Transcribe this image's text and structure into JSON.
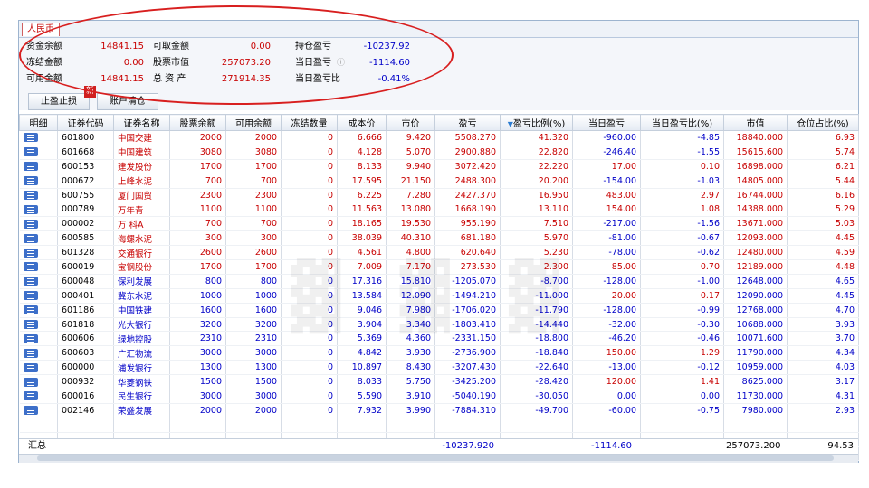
{
  "tab": {
    "label": "人民币"
  },
  "account": {
    "cash_balance_label": "资金余额",
    "cash_balance": "14841.15",
    "withdrawable_label": "可取金额",
    "withdrawable": "0.00",
    "position_pl_label": "持仓盈亏",
    "position_pl": "-10237.92",
    "frozen_label": "冻结金额",
    "frozen": "0.00",
    "stock_value_label": "股票市值",
    "stock_value": "257073.20",
    "today_pl_label": "当日盈亏",
    "today_pl": "-1114.60",
    "available_label": "可用金额",
    "available": "14841.15",
    "total_assets_label": "总 资 产",
    "total_assets": "271914.35",
    "today_pl_ratio_label": "当日盈亏比",
    "today_pl_ratio": "-0.41%"
  },
  "buttons": {
    "stop_label": "止盈止损",
    "new_badge": "新",
    "clear_label": "账户清仓"
  },
  "columns": [
    "明细",
    "证券代码",
    "证券名称",
    "股票余额",
    "可用余额",
    "冻结数量",
    "成本价",
    "市价",
    "盈亏",
    "盈亏比例(%)",
    "当日盈亏",
    "当日盈亏比(%)",
    "市值",
    "仓位占比(%)"
  ],
  "rows": [
    {
      "code": "601800",
      "name": "中国交建",
      "bal": "2000",
      "avail": "2000",
      "frozen": "0",
      "cost": "6.666",
      "price": "9.420",
      "pl": "5508.270",
      "plr": "41.320",
      "dpl": "-960.00",
      "dplr": "-4.85",
      "mv": "18840.000",
      "pos": "6.93",
      "up": true
    },
    {
      "code": "601668",
      "name": "中国建筑",
      "bal": "3080",
      "avail": "3080",
      "frozen": "0",
      "cost": "4.128",
      "price": "5.070",
      "pl": "2900.880",
      "plr": "22.820",
      "dpl": "-246.40",
      "dplr": "-1.55",
      "mv": "15615.600",
      "pos": "5.74",
      "up": true
    },
    {
      "code": "600153",
      "name": "建发股份",
      "bal": "1700",
      "avail": "1700",
      "frozen": "0",
      "cost": "8.133",
      "price": "9.940",
      "pl": "3072.420",
      "plr": "22.220",
      "dpl": "17.00",
      "dplr": "0.10",
      "mv": "16898.000",
      "pos": "6.21",
      "up": true
    },
    {
      "code": "000672",
      "name": "上峰水泥",
      "bal": "700",
      "avail": "700",
      "frozen": "0",
      "cost": "17.595",
      "price": "21.150",
      "pl": "2488.300",
      "plr": "20.200",
      "dpl": "-154.00",
      "dplr": "-1.03",
      "mv": "14805.000",
      "pos": "5.44",
      "up": true
    },
    {
      "code": "600755",
      "name": "厦门国贸",
      "bal": "2300",
      "avail": "2300",
      "frozen": "0",
      "cost": "6.225",
      "price": "7.280",
      "pl": "2427.370",
      "plr": "16.950",
      "dpl": "483.00",
      "dplr": "2.97",
      "mv": "16744.000",
      "pos": "6.16",
      "up": true
    },
    {
      "code": "000789",
      "name": "万年青",
      "bal": "1100",
      "avail": "1100",
      "frozen": "0",
      "cost": "11.563",
      "price": "13.080",
      "pl": "1668.190",
      "plr": "13.110",
      "dpl": "154.00",
      "dplr": "1.08",
      "mv": "14388.000",
      "pos": "5.29",
      "up": true
    },
    {
      "code": "000002",
      "name": "万 科A",
      "bal": "700",
      "avail": "700",
      "frozen": "0",
      "cost": "18.165",
      "price": "19.530",
      "pl": "955.190",
      "plr": "7.510",
      "dpl": "-217.00",
      "dplr": "-1.56",
      "mv": "13671.000",
      "pos": "5.03",
      "up": true
    },
    {
      "code": "600585",
      "name": "海螺水泥",
      "bal": "300",
      "avail": "300",
      "frozen": "0",
      "cost": "38.039",
      "price": "40.310",
      "pl": "681.180",
      "plr": "5.970",
      "dpl": "-81.00",
      "dplr": "-0.67",
      "mv": "12093.000",
      "pos": "4.45",
      "up": true
    },
    {
      "code": "601328",
      "name": "交通银行",
      "bal": "2600",
      "avail": "2600",
      "frozen": "0",
      "cost": "4.561",
      "price": "4.800",
      "pl": "620.640",
      "plr": "5.230",
      "dpl": "-78.00",
      "dplr": "-0.62",
      "mv": "12480.000",
      "pos": "4.59",
      "up": true
    },
    {
      "code": "600019",
      "name": "宝钢股份",
      "bal": "1700",
      "avail": "1700",
      "frozen": "0",
      "cost": "7.009",
      "price": "7.170",
      "pl": "273.530",
      "plr": "2.300",
      "dpl": "85.00",
      "dplr": "0.70",
      "mv": "12189.000",
      "pos": "4.48",
      "up": true
    },
    {
      "code": "600048",
      "name": "保利发展",
      "bal": "800",
      "avail": "800",
      "frozen": "0",
      "cost": "17.316",
      "price": "15.810",
      "pl": "-1205.070",
      "plr": "-8.700",
      "dpl": "-128.00",
      "dplr": "-1.00",
      "mv": "12648.000",
      "pos": "4.65",
      "up": false
    },
    {
      "code": "000401",
      "name": "冀东水泥",
      "bal": "1000",
      "avail": "1000",
      "frozen": "0",
      "cost": "13.584",
      "price": "12.090",
      "pl": "-1494.210",
      "plr": "-11.000",
      "dpl": "20.00",
      "dplr": "0.17",
      "mv": "12090.000",
      "pos": "4.45",
      "up": false
    },
    {
      "code": "601186",
      "name": "中国铁建",
      "bal": "1600",
      "avail": "1600",
      "frozen": "0",
      "cost": "9.046",
      "price": "7.980",
      "pl": "-1706.020",
      "plr": "-11.790",
      "dpl": "-128.00",
      "dplr": "-0.99",
      "mv": "12768.000",
      "pos": "4.70",
      "up": false
    },
    {
      "code": "601818",
      "name": "光大银行",
      "bal": "3200",
      "avail": "3200",
      "frozen": "0",
      "cost": "3.904",
      "price": "3.340",
      "pl": "-1803.410",
      "plr": "-14.440",
      "dpl": "-32.00",
      "dplr": "-0.30",
      "mv": "10688.000",
      "pos": "3.93",
      "up": false
    },
    {
      "code": "600606",
      "name": "绿地控股",
      "bal": "2310",
      "avail": "2310",
      "frozen": "0",
      "cost": "5.369",
      "price": "4.360",
      "pl": "-2331.150",
      "plr": "-18.800",
      "dpl": "-46.20",
      "dplr": "-0.46",
      "mv": "10071.600",
      "pos": "3.70",
      "up": false
    },
    {
      "code": "600603",
      "name": "广汇物流",
      "bal": "3000",
      "avail": "3000",
      "frozen": "0",
      "cost": "4.842",
      "price": "3.930",
      "pl": "-2736.900",
      "plr": "-18.840",
      "dpl": "150.00",
      "dplr": "1.29",
      "mv": "11790.000",
      "pos": "4.34",
      "up": false
    },
    {
      "code": "600000",
      "name": "浦发银行",
      "bal": "1300",
      "avail": "1300",
      "frozen": "0",
      "cost": "10.897",
      "price": "8.430",
      "pl": "-3207.430",
      "plr": "-22.640",
      "dpl": "-13.00",
      "dplr": "-0.12",
      "mv": "10959.000",
      "pos": "4.03",
      "up": false
    },
    {
      "code": "000932",
      "name": "华菱钢铁",
      "bal": "1500",
      "avail": "1500",
      "frozen": "0",
      "cost": "8.033",
      "price": "5.750",
      "pl": "-3425.200",
      "plr": "-28.420",
      "dpl": "120.00",
      "dplr": "1.41",
      "mv": "8625.000",
      "pos": "3.17",
      "up": false
    },
    {
      "code": "600016",
      "name": "民生银行",
      "bal": "3000",
      "avail": "3000",
      "frozen": "0",
      "cost": "5.590",
      "price": "3.910",
      "pl": "-5040.190",
      "plr": "-30.050",
      "dpl": "0.00",
      "dplr": "0.00",
      "mv": "11730.000",
      "pos": "4.31",
      "up": false
    },
    {
      "code": "002146",
      "name": "荣盛发展",
      "bal": "2000",
      "avail": "2000",
      "frozen": "0",
      "cost": "7.932",
      "price": "3.990",
      "pl": "-7884.310",
      "plr": "-49.700",
      "dpl": "-60.00",
      "dplr": "-0.75",
      "mv": "7980.000",
      "pos": "2.93",
      "up": false
    }
  ],
  "summary": {
    "label": "汇总",
    "pl": "-10237.920",
    "dpl": "-1114.60",
    "mv": "257073.200",
    "pos": "94.53"
  },
  "colors": {
    "positive": "#c80000",
    "negative": "#0000c8",
    "highlight_oval": "#d81f1f"
  }
}
